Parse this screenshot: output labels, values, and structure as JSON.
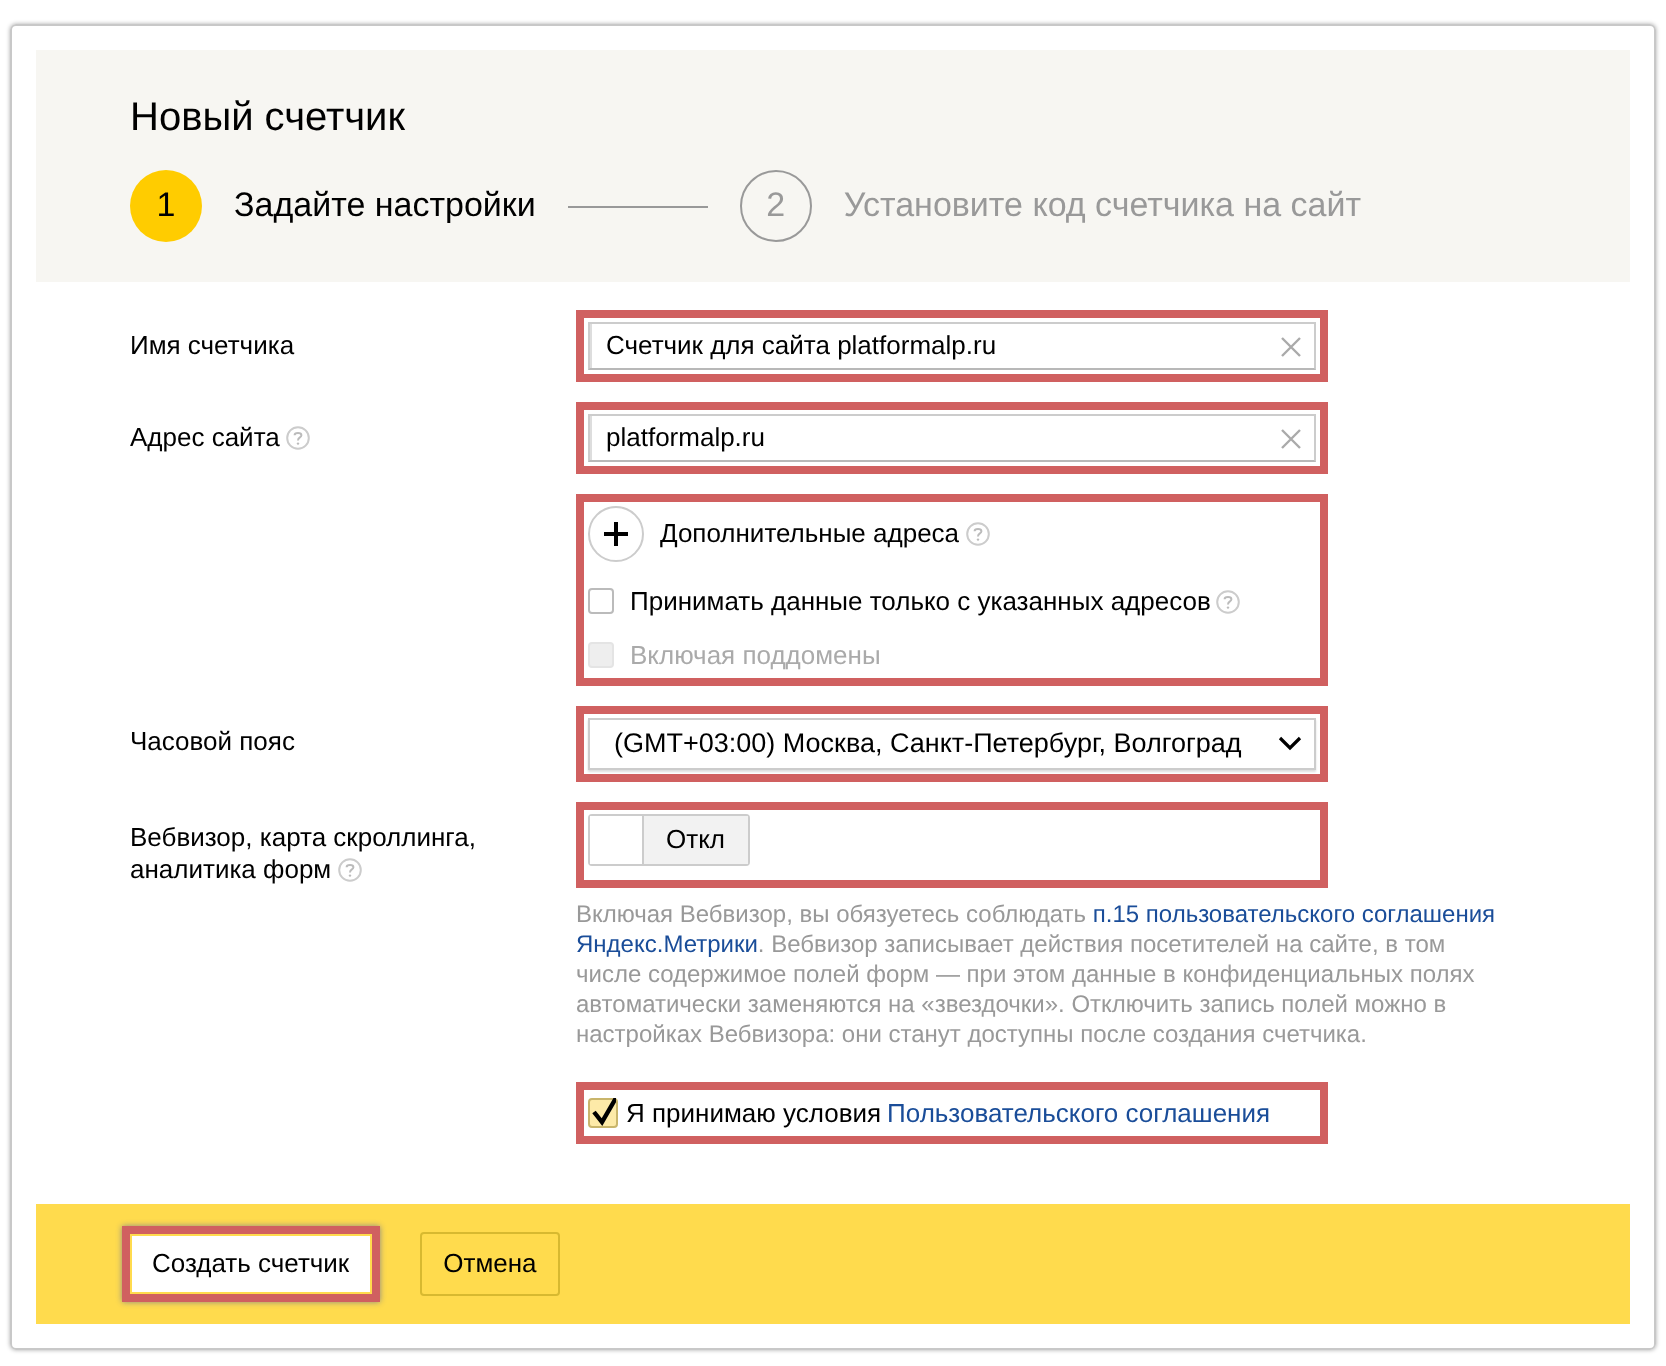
{
  "title": "Новый счетчик",
  "steps": [
    {
      "number": "1",
      "label": "Задайте настройки",
      "selected": true
    },
    {
      "number": "2",
      "label": "Установите код счетчика на сайт",
      "selected": false
    }
  ],
  "form": [
    {
      "kind": "text",
      "label": "Имя счетчика",
      "value": "Счетчик для сайта platformalp.ru",
      "highlighted": true
    },
    {
      "kind": "text",
      "label": "Адрес сайта",
      "help": true,
      "value": "platformalp.ru",
      "highlighted": true
    },
    {
      "kind": "extra",
      "highlighted": true,
      "add_label": "Дополнительные адреса",
      "add_help": true,
      "options": [
        {
          "label": "Принимать данные только с указанных адресов",
          "checked": false,
          "disabled": false,
          "help": true
        },
        {
          "label": "Включая поддомены",
          "checked": false,
          "disabled": true
        }
      ]
    },
    {
      "kind": "select",
      "label": "Часовой пояс",
      "value": "(GMT+03:00) Москва, Санкт-Петербург, Волгоград",
      "highlighted": true
    },
    {
      "kind": "toggle",
      "label": "Вебвизор, карта скроллинга, аналитика форм",
      "help": true,
      "on": false,
      "state_text": "Откл",
      "highlighted": true,
      "note": [
        {
          "kind": "text",
          "text": "Включая Вебвизор, вы обязуетесь соблюдать "
        },
        {
          "kind": "link",
          "text": "п.15 пользовательского соглашения"
        },
        {
          "kind": "link",
          "text": "Яндекс.Метрики"
        },
        {
          "kind": "text",
          "text": ". Вебвизор записывает действия посетителей на сайте, в том числе содержимое полей форм — при этом данные в конфиденциальных полях автоматически заменяются на «звездочки». Отключить запись полей можно в настройках Вебвизора: они станут доступны после создания счетчика."
        }
      ]
    },
    {
      "kind": "agree",
      "checked": true,
      "highlighted": true,
      "text": "Я принимаю условия",
      "link": "Пользовательского соглашения"
    }
  ],
  "buttons": [
    {
      "label": "Создать счетчик",
      "kind": "primary",
      "highlighted": true
    },
    {
      "label": "Отмена",
      "kind": "secondary",
      "highlighted": false
    }
  ]
}
